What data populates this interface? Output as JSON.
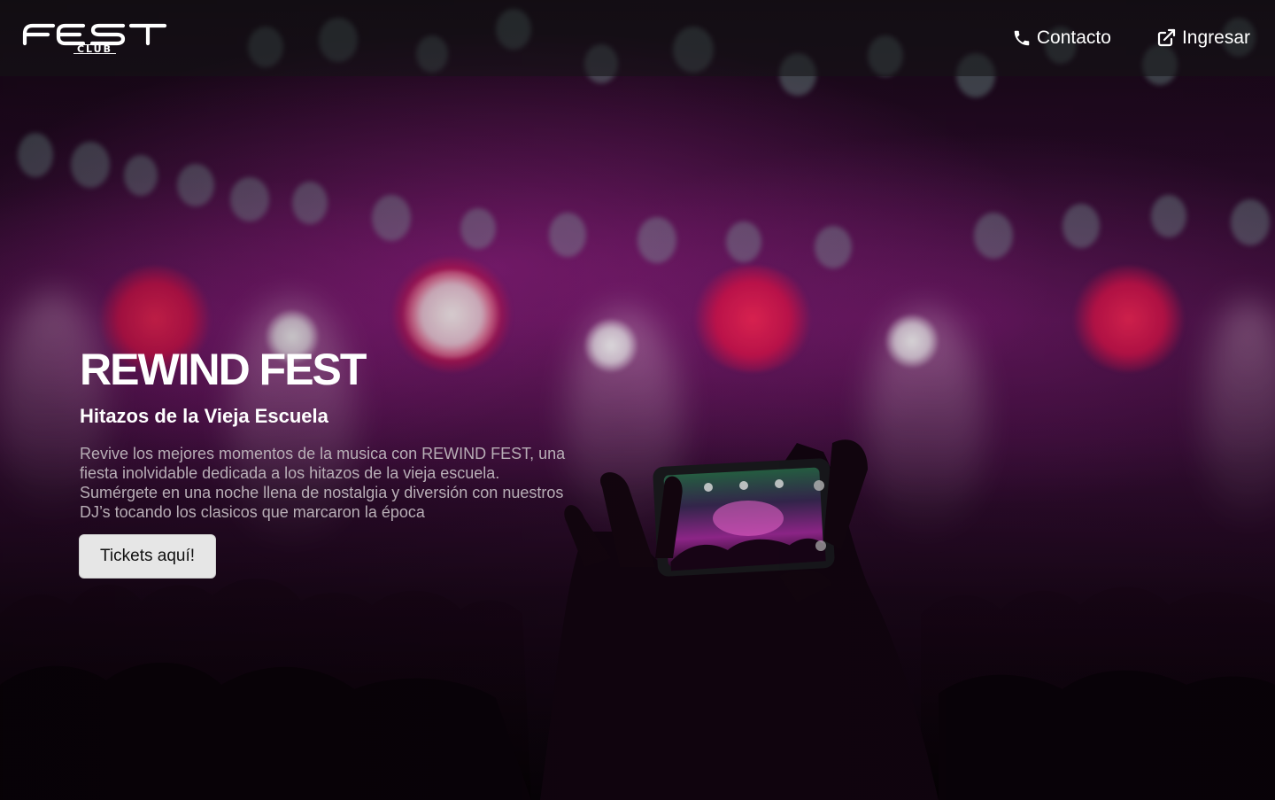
{
  "brand": {
    "logo_main": "FEST",
    "logo_sub": "CLUB"
  },
  "nav": {
    "contact_label": "Contacto",
    "contact_icon": "phone-icon",
    "login_label": "Ingresar",
    "login_icon": "external-link-icon"
  },
  "hero": {
    "title": "REWIND FEST",
    "subtitle": "Hitazos de la Vieja Escuela",
    "description": "Revive los mejores momentos de la musica con REWIND FEST, una fiesta inolvidable dedicada a los hitazos de la vieja escuela. Sumérgete en una noche llena de nostalgia y diversión con nuestros DJ’s tocando los clasicos que marcaron la época",
    "cta_label": "Tickets aquí!"
  },
  "colors": {
    "header_bg": "#141416",
    "text_primary": "#ffffff",
    "text_muted": "#b8aeb6",
    "button_bg": "#e6e6e6",
    "accent_stage": "#be28aa"
  }
}
